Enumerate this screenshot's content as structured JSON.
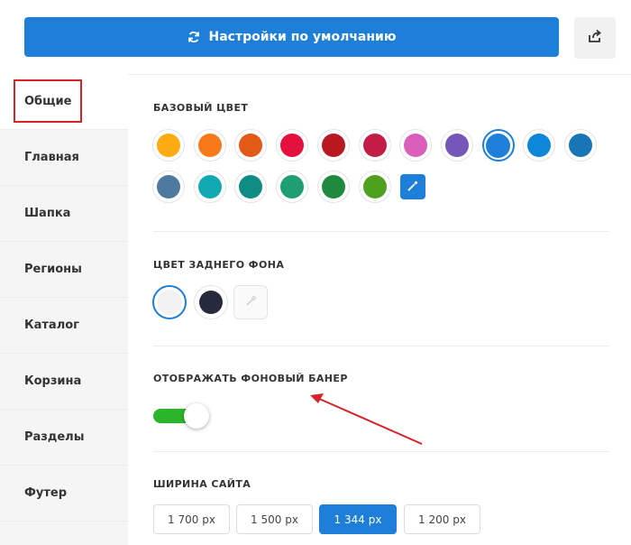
{
  "header": {
    "reset_label": "Настройки по умолчанию",
    "reset_icon": "refresh-icon",
    "share_icon": "share-icon"
  },
  "sidebar": {
    "items": [
      {
        "label": "Общие",
        "active": true
      },
      {
        "label": "Главная"
      },
      {
        "label": "Шапка"
      },
      {
        "label": "Регионы"
      },
      {
        "label": "Каталог"
      },
      {
        "label": "Корзина"
      },
      {
        "label": "Разделы"
      },
      {
        "label": "Футер"
      }
    ]
  },
  "base_color": {
    "title": "БАЗОВЫЙ ЦВЕТ",
    "selected": "#1e7fd8",
    "colors": [
      "#fcac12",
      "#f77919",
      "#e35a17",
      "#e30f3c",
      "#b8191f",
      "#c41d45",
      "#d95fbb",
      "#7457b8",
      "#1e7fd8",
      "#0d87d8",
      "#1976b6",
      "#4e7a9e",
      "#12a9b2",
      "#0f8c84",
      "#1f9e74",
      "#1f8a3d",
      "#4da11e"
    ],
    "picker_icon": "eyedropper-icon"
  },
  "background_color": {
    "title": "ЦВЕТ ЗАДНЕГО ФОНА",
    "colors": [
      "#f2f2f2",
      "#262a3c"
    ],
    "selected": "#f2f2f2",
    "picker_icon": "eyedropper-icon"
  },
  "banner": {
    "title": "ОТОБРАЖАТЬ ФОНОВЫЙ БАНЕР",
    "enabled": true
  },
  "site_width": {
    "title": "ШИРИНА САЙТА",
    "options": [
      "1 700 px",
      "1 500 px",
      "1 344 px",
      "1 200 px"
    ],
    "selected": "1 344 px"
  },
  "annotation": {
    "color": "#d4242a"
  }
}
